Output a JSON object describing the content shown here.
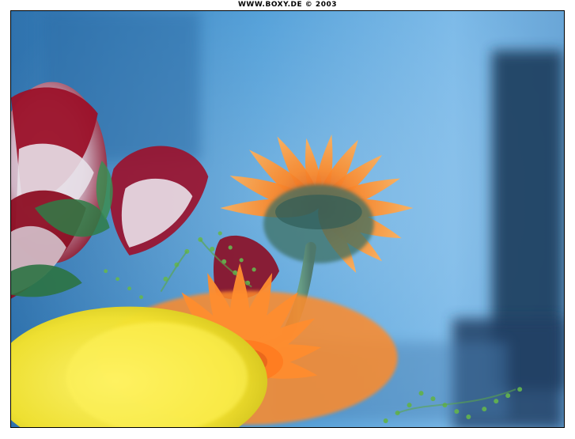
{
  "caption": "WWW.BOXY.DE © 2003",
  "photo": {
    "subject": "flower-photo",
    "colors": {
      "background": "#3f8dcc",
      "background_light": "#77b8e6",
      "background_dark": "#1e3d5d",
      "gerbera_orange": "#ff8a2a",
      "gerbera_dark": "#d8581a",
      "stem_green": "#5f8a76",
      "rose_red": "#a11029",
      "rose_light": "#e8dfe9",
      "yellow_flower": "#f6e73a",
      "leaf_green": "#4ba245"
    }
  }
}
